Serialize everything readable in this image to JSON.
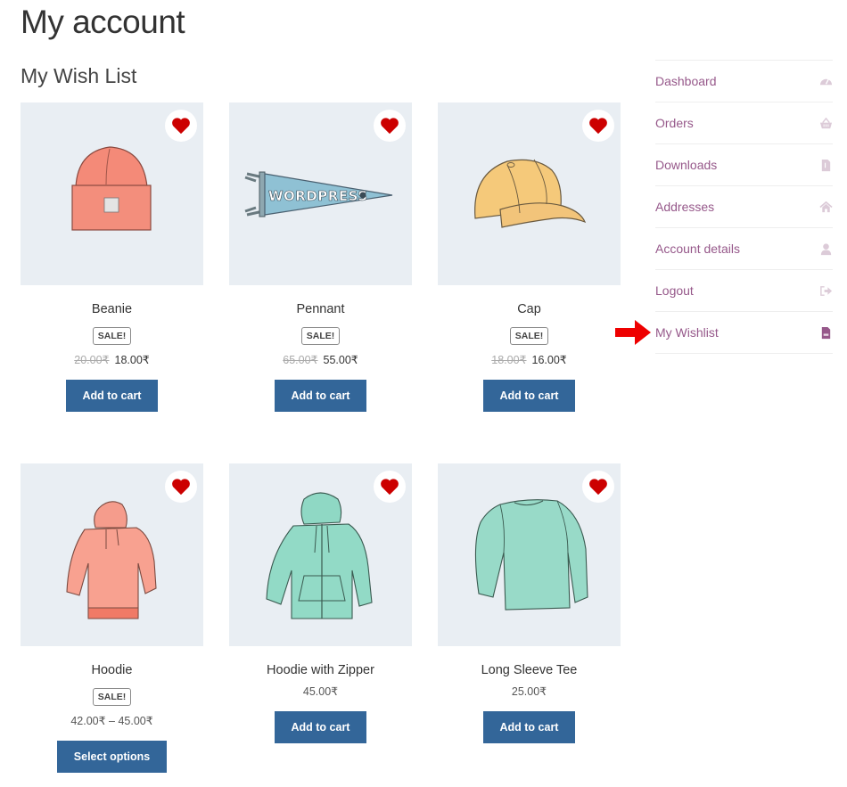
{
  "page": {
    "title": "My account",
    "section_title": "My Wish List"
  },
  "colors": {
    "accent_link": "#96588a",
    "button_bg": "#336699",
    "heart": "#cc0000",
    "arrow": "#ee0000",
    "thumb_bg": "#e9eef3"
  },
  "products": [
    {
      "name": "Beanie",
      "sale_badge": "SALE!",
      "old_price": "20.00₹",
      "price": "18.00₹",
      "button": "Add to cart",
      "image": "beanie-illustration",
      "wishlist_icon": "heart-icon"
    },
    {
      "name": "Pennant",
      "sale_badge": "SALE!",
      "old_price": "65.00₹",
      "price": "55.00₹",
      "button": "Add to cart",
      "image": "pennant-illustration",
      "pennant_text": "WORDPRESS",
      "wishlist_icon": "heart-icon"
    },
    {
      "name": "Cap",
      "sale_badge": "SALE!",
      "old_price": "18.00₹",
      "price": "16.00₹",
      "button": "Add to cart",
      "image": "cap-illustration",
      "wishlist_icon": "heart-icon"
    },
    {
      "name": "Hoodie",
      "sale_badge": "SALE!",
      "price": "42.00₹ – 45.00₹",
      "button": "Select options",
      "image": "hoodie-illustration",
      "wishlist_icon": "heart-icon"
    },
    {
      "name": "Hoodie with Zipper",
      "price": "45.00₹",
      "button": "Add to cart",
      "image": "zip-hoodie-illustration",
      "wishlist_icon": "heart-icon"
    },
    {
      "name": "Long Sleeve Tee",
      "price": "25.00₹",
      "button": "Add to cart",
      "image": "long-sleeve-tee-illustration",
      "wishlist_icon": "heart-icon"
    }
  ],
  "account_nav": {
    "items": [
      {
        "label": "Dashboard",
        "icon": "dashboard-gauge-icon"
      },
      {
        "label": "Orders",
        "icon": "basket-icon"
      },
      {
        "label": "Downloads",
        "icon": "file-download-icon"
      },
      {
        "label": "Addresses",
        "icon": "home-icon"
      },
      {
        "label": "Account details",
        "icon": "user-icon"
      },
      {
        "label": "Logout",
        "icon": "sign-out-icon"
      },
      {
        "label": "My Wishlist",
        "icon": "document-icon",
        "active": true
      }
    ]
  }
}
